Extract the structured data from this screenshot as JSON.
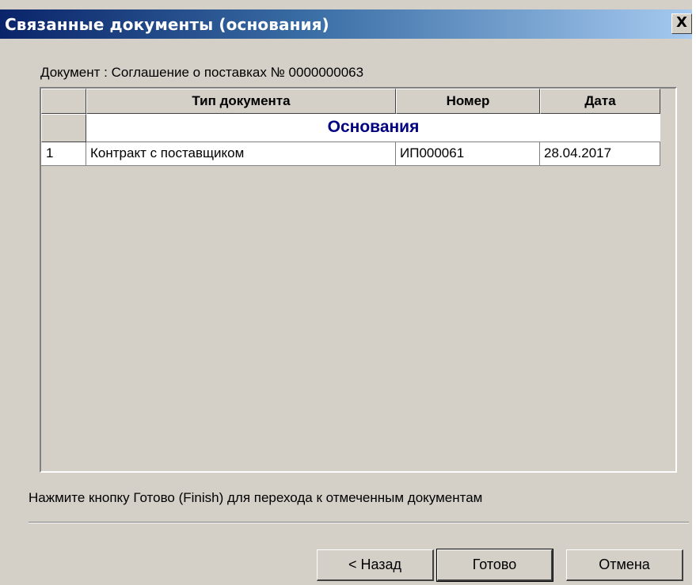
{
  "window": {
    "title": "Связанные документы (основания)",
    "close_glyph": "X"
  },
  "document_label": "Документ : Соглашение о поставках № 0000000063",
  "table": {
    "columns": [
      "Тип документа",
      "Номер",
      "Дата"
    ],
    "group_title": "Основания",
    "rows": [
      {
        "num": "1",
        "type": "Контракт с поставщиком",
        "number": "ИП000061",
        "date": "28.04.2017"
      }
    ]
  },
  "hint": "Нажмите кнопку Готово (Finish) для перехода к отмеченным документам",
  "buttons": {
    "back": "< Назад",
    "finish": "Готово",
    "cancel": "Отмена"
  },
  "colors": {
    "title_gradient_start": "#0a246a",
    "title_gradient_end": "#a6caf0",
    "dialog_face": "#d4d0c8",
    "group_text": "#000080"
  },
  "icons": [
    "close-icon"
  ]
}
